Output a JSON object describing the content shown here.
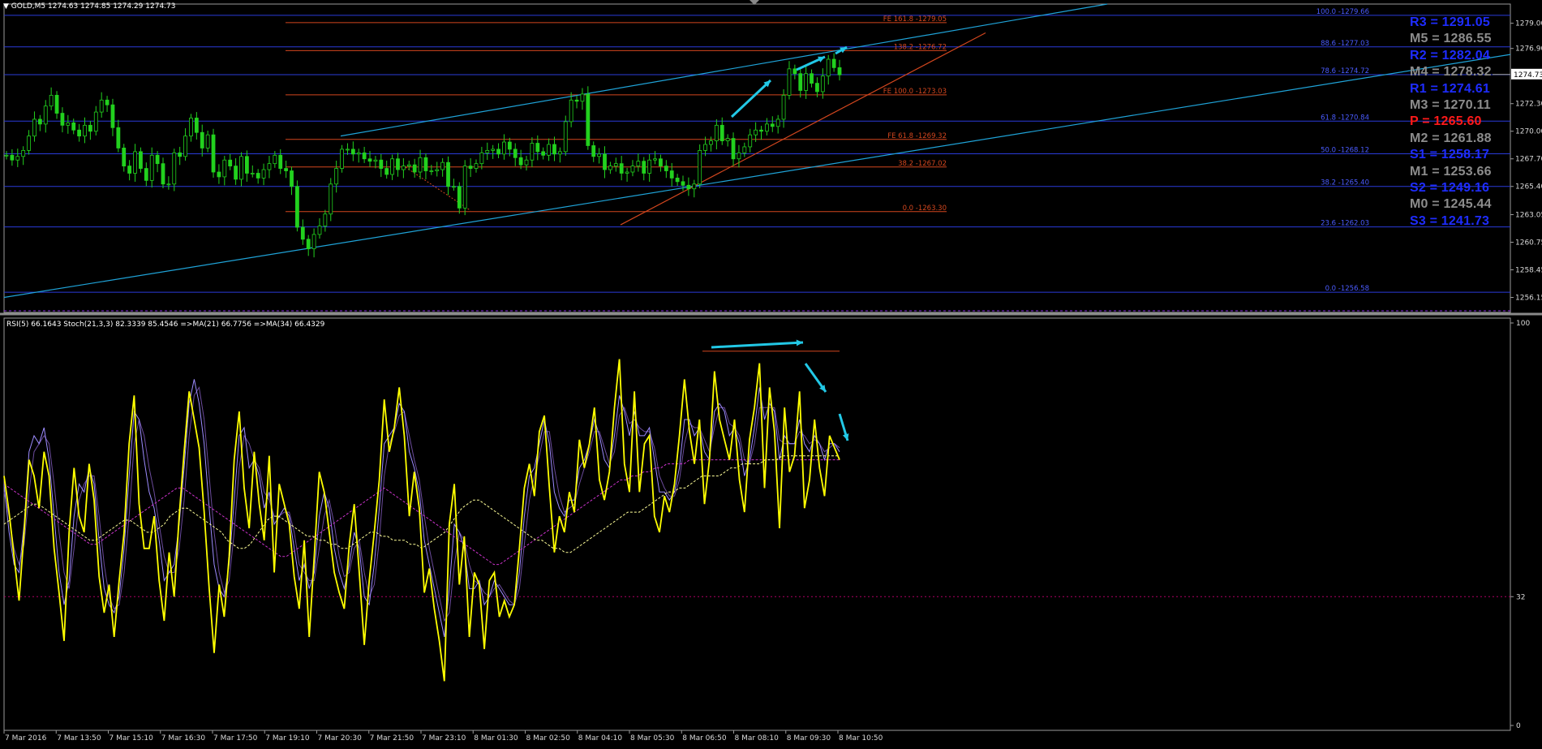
{
  "header": {
    "symbol": "GOLD,M5",
    "ohlc": "1274.63 1274.85 1274.29 1274.73"
  },
  "indicator_header": "RSI(5) 66.1643  Stoch(21,3,3) 82.3339 85.4546  =>MA(21) 66.7756  =>MA(34) 66.4329",
  "pivots": [
    {
      "label": "R3 = 1291.05",
      "color": "#1e2cff"
    },
    {
      "label": "M5 = 1286.55",
      "color": "#8c8c8c"
    },
    {
      "label": "R2 = 1282.04",
      "color": "#1e2cff"
    },
    {
      "label": "M4 = 1278.32",
      "color": "#8c8c8c"
    },
    {
      "label": "R1 = 1274.61",
      "color": "#1e2cff"
    },
    {
      "label": "M3 = 1270.11",
      "color": "#8c8c8c"
    },
    {
      "label": "P   = 1265.60",
      "color": "#ff1a1a"
    },
    {
      "label": "M2 = 1261.88",
      "color": "#8c8c8c"
    },
    {
      "label": "S1 = 1258.17",
      "color": "#1e2cff"
    },
    {
      "label": "M1 = 1253.66",
      "color": "#8c8c8c"
    },
    {
      "label": "S2 = 1249.16",
      "color": "#1e2cff"
    },
    {
      "label": "M0 = 1245.44",
      "color": "#8c8c8c"
    },
    {
      "label": "S3 = 1241.73",
      "color": "#1e2cff"
    }
  ],
  "chart_data": [
    {
      "type": "candlestick",
      "title": "GOLD,M5",
      "ylim": [
        1254.9,
        1280.6
      ],
      "price_ticks": [
        "1279.00",
        "1276.90",
        "1274.73",
        "1272.30",
        "1270.00",
        "1267.70",
        "1265.40",
        "1263.05",
        "1260.75",
        "1258.45",
        "1256.15"
      ],
      "current_price": "1274.73",
      "fib_retracement": [
        {
          "label": "100.0 -1279.66",
          "price": 1279.66
        },
        {
          "label": "88.6 -1277.03",
          "price": 1277.03
        },
        {
          "label": "78.6 -1274.72",
          "price": 1274.72
        },
        {
          "label": "61.8 -1270.84",
          "price": 1270.84
        },
        {
          "label": "50.0 -1268.12",
          "price": 1268.12
        },
        {
          "label": "38.2 -1265.40",
          "price": 1265.4
        },
        {
          "label": "23.6 -1262.03",
          "price": 1262.03
        },
        {
          "label": "0.0 -1256.58",
          "price": 1256.58
        }
      ],
      "fib_expansion": [
        {
          "label": "FE 161.8 -1279.05",
          "price": 1279.05
        },
        {
          "label": "138.2 -1276.72",
          "price": 1276.72
        },
        {
          "label": "FE 100.0 -1273.03",
          "price": 1273.03
        },
        {
          "label": "FE 61.8 -1269.32",
          "price": 1269.32
        },
        {
          "label": "38.2 -1267.02",
          "price": 1267.02
        },
        {
          "label": "0.0 -1263.30",
          "price": 1263.3
        }
      ],
      "candles_close": [
        1268.0,
        1267.6,
        1267.9,
        1268.4,
        1269.6,
        1271.0,
        1270.6,
        1272.1,
        1273.0,
        1271.5,
        1270.5,
        1270.7,
        1270.1,
        1269.6,
        1270.5,
        1270.0,
        1271.6,
        1272.6,
        1272.2,
        1270.3,
        1268.6,
        1267.1,
        1266.5,
        1268.3,
        1266.9,
        1265.9,
        1268.0,
        1267.3,
        1265.6,
        1265.6,
        1268.2,
        1267.9,
        1269.6,
        1271.1,
        1269.9,
        1268.6,
        1269.7,
        1266.6,
        1266.2,
        1267.6,
        1267.1,
        1266.0,
        1267.9,
        1266.5,
        1266.5,
        1266.1,
        1266.8,
        1267.3,
        1268.0,
        1266.9,
        1266.7,
        1265.4,
        1262.0,
        1261.0,
        1260.2,
        1261.4,
        1262.1,
        1263.1,
        1265.6,
        1266.9,
        1268.5,
        1268.5,
        1268.1,
        1268.2,
        1267.7,
        1267.5,
        1267.6,
        1266.9,
        1266.4,
        1267.7,
        1266.8,
        1267.1,
        1267.2,
        1266.6,
        1267.8,
        1266.7,
        1266.7,
        1266.8,
        1267.4,
        1265.4,
        1265.4,
        1263.6,
        1267.1,
        1266.9,
        1267.3,
        1268.2,
        1268.4,
        1268.5,
        1268.1,
        1269.1,
        1268.5,
        1267.8,
        1267.2,
        1267.6,
        1269.0,
        1268.3,
        1268.0,
        1268.9,
        1268.1,
        1268.3,
        1270.8,
        1272.6,
        1272.5,
        1273.1,
        1268.8,
        1267.9,
        1268.1,
        1266.8,
        1267.1,
        1267.3,
        1266.5,
        1266.6,
        1267.1,
        1267.5,
        1266.5,
        1267.6,
        1267.7,
        1267.1,
        1266.7,
        1266.1,
        1265.8,
        1265.5,
        1265.2,
        1265.6,
        1268.4,
        1268.9,
        1269.2,
        1270.5,
        1269.2,
        1269.4,
        1267.7,
        1268.2,
        1268.7,
        1269.7,
        1270.1,
        1270.0,
        1270.6,
        1270.4,
        1271.0,
        1273.0,
        1275.2,
        1274.8,
        1273.4,
        1274.8,
        1274.0,
        1273.3,
        1274.6,
        1276.0,
        1275.3,
        1274.7
      ],
      "time_labels": [
        "7 Mar 2016",
        "7 Mar 13:50",
        "7 Mar 15:10",
        "7 Mar 16:30",
        "7 Mar 17:50",
        "7 Mar 19:10",
        "7 Mar 20:30",
        "7 Mar 21:50",
        "7 Mar 23:10",
        "8 Mar 01:30",
        "8 Mar 02:50",
        "8 Mar 04:10",
        "8 Mar 05:30",
        "8 Mar 06:50",
        "8 Mar 08:10",
        "8 Mar 09:30",
        "8 Mar 10:50"
      ]
    },
    {
      "type": "line",
      "title": "RSI(5) 66.1643  Stoch(21,3,3) 82.3339 85.4546  =>MA(21) 66.7756  =>MA(34) 66.4329",
      "ylim": [
        0,
        100
      ],
      "y_ticks": [
        "100",
        "32",
        "0"
      ],
      "levels": [
        32
      ],
      "series": [
        {
          "name": "RSI(5)",
          "color": "#ffff00",
          "values": [
            62,
            53,
            42,
            31,
            48,
            66,
            62,
            54,
            68,
            62,
            44,
            33,
            21,
            48,
            64,
            52,
            48,
            65,
            56,
            37,
            28,
            35,
            22,
            36,
            48,
            70,
            82,
            55,
            44,
            44,
            52,
            36,
            26,
            43,
            32,
            52,
            68,
            83,
            76,
            69,
            53,
            34,
            18,
            35,
            27,
            42,
            66,
            78,
            59,
            49,
            68,
            55,
            46,
            67,
            38,
            60,
            55,
            50,
            37,
            29,
            46,
            22,
            42,
            63,
            58,
            48,
            38,
            33,
            29,
            45,
            55,
            38,
            20,
            36,
            48,
            61,
            81,
            68,
            74,
            84,
            72,
            52,
            63,
            54,
            33,
            39,
            29,
            21,
            11,
            50,
            60,
            35,
            47,
            22,
            38,
            35,
            19,
            36,
            38,
            27,
            31,
            27,
            30,
            44,
            59,
            65,
            57,
            73,
            77,
            59,
            43,
            52,
            48,
            58,
            53,
            71,
            64,
            70,
            79,
            61,
            56,
            63,
            79,
            91,
            65,
            58,
            83,
            58,
            70,
            72,
            52,
            48,
            57,
            53,
            60,
            72,
            86,
            73,
            65,
            76,
            55,
            66,
            88,
            76,
            71,
            66,
            76,
            61,
            53,
            71,
            79,
            90,
            59,
            84,
            73,
            49,
            79,
            63,
            67,
            83,
            54,
            61,
            76,
            64,
            57,
            72,
            69,
            66
          ]
        },
        {
          "name": "Stoch main",
          "color": "#9d8cff",
          "values": [
            60,
            48,
            40,
            38,
            50,
            68,
            72,
            70,
            74,
            66,
            52,
            38,
            30,
            36,
            52,
            60,
            58,
            64,
            60,
            46,
            34,
            30,
            28,
            32,
            44,
            62,
            78,
            76,
            66,
            58,
            54,
            46,
            36,
            38,
            40,
            50,
            64,
            80,
            86,
            80,
            70,
            54,
            40,
            34,
            32,
            40,
            56,
            72,
            74,
            64,
            66,
            62,
            54,
            58,
            50,
            52,
            54,
            52,
            44,
            36,
            40,
            34,
            38,
            52,
            58,
            54,
            44,
            38,
            34,
            40,
            48,
            44,
            32,
            30,
            40,
            54,
            70,
            72,
            74,
            80,
            78,
            68,
            64,
            58,
            46,
            40,
            34,
            28,
            22,
            34,
            50,
            48,
            44,
            34,
            34,
            36,
            30,
            32,
            36,
            34,
            32,
            30,
            30,
            38,
            52,
            62,
            64,
            70,
            76,
            70,
            58,
            54,
            52,
            56,
            56,
            64,
            66,
            70,
            76,
            72,
            66,
            64,
            72,
            82,
            78,
            72,
            78,
            72,
            72,
            74,
            66,
            58,
            58,
            56,
            58,
            64,
            76,
            76,
            72,
            74,
            68,
            66,
            78,
            80,
            78,
            72,
            74,
            70,
            62,
            66,
            74,
            84,
            76,
            80,
            78,
            66,
            72,
            70,
            70,
            76,
            70,
            68,
            72,
            70,
            66,
            70,
            70,
            68
          ]
        },
        {
          "name": "Stoch signal",
          "color": "#6b4b9c",
          "values": [
            58,
            52,
            44,
            40,
            45,
            58,
            68,
            70,
            72,
            70,
            60,
            48,
            38,
            34,
            44,
            56,
            60,
            62,
            62,
            52,
            40,
            32,
            29,
            30,
            38,
            52,
            70,
            76,
            72,
            64,
            58,
            50,
            42,
            38,
            38,
            44,
            56,
            72,
            82,
            84,
            76,
            62,
            48,
            38,
            33,
            36,
            48,
            64,
            72,
            70,
            66,
            64,
            58,
            56,
            52,
            52,
            53,
            53,
            48,
            40,
            38,
            36,
            36,
            44,
            52,
            56,
            50,
            42,
            37,
            38,
            44,
            46,
            38,
            32,
            35,
            46,
            62,
            70,
            73,
            77,
            78,
            72,
            66,
            61,
            52,
            44,
            38,
            32,
            26,
            28,
            40,
            48,
            46,
            40,
            36,
            35,
            33,
            32,
            34,
            35,
            33,
            31,
            30,
            34,
            45,
            56,
            62,
            67,
            73,
            73,
            64,
            57,
            53,
            54,
            55,
            60,
            64,
            68,
            73,
            73,
            69,
            65,
            68,
            77,
            79,
            75,
            76,
            74,
            73,
            73,
            69,
            62,
            59,
            57,
            57,
            61,
            70,
            75,
            74,
            74,
            71,
            68,
            74,
            79,
            79,
            75,
            74,
            72,
            66,
            65,
            70,
            79,
            79,
            79,
            79,
            71,
            70,
            70,
            70,
            73,
            72,
            70,
            71,
            70,
            68,
            69,
            70,
            69
          ]
        },
        {
          "name": "MA(21)",
          "color": "#ffff99",
          "values": [
            50,
            51,
            52,
            53,
            54,
            55,
            55,
            54,
            53,
            52,
            51,
            50,
            49,
            48,
            47,
            46,
            46,
            47,
            48,
            49,
            50,
            51,
            51,
            50,
            49,
            48,
            48,
            49,
            50,
            52,
            53,
            54,
            54,
            53,
            52,
            51,
            50,
            49,
            48,
            46,
            45,
            44,
            44,
            45,
            47,
            49,
            51,
            52,
            52,
            51,
            50,
            49,
            48,
            47,
            47,
            46,
            46,
            45,
            45,
            44,
            44,
            45,
            46,
            47,
            48,
            48,
            47,
            47,
            46,
            46,
            46,
            45,
            45,
            44,
            45,
            46,
            47,
            48,
            50,
            52,
            54,
            55,
            56,
            56,
            55,
            54,
            53,
            52,
            51,
            50,
            49,
            48,
            47,
            46,
            46,
            45,
            44,
            44,
            43,
            43,
            44,
            45,
            46,
            47,
            48,
            49,
            50,
            51,
            52,
            53,
            53,
            53,
            54,
            55,
            56,
            57,
            58,
            58,
            59,
            59,
            60,
            61,
            62,
            62,
            62,
            62,
            63,
            64,
            64,
            65,
            65,
            65,
            65,
            66,
            66,
            66,
            67,
            67,
            67,
            67,
            67,
            67,
            67,
            67,
            67,
            67,
            67
          ]
        },
        {
          "name": "MA(34)",
          "color": "#cc33cc",
          "values": [
            60,
            59,
            58,
            57,
            56,
            55,
            54,
            53,
            52,
            51,
            50,
            49,
            48,
            47,
            46,
            45,
            45,
            46,
            47,
            48,
            49,
            50,
            51,
            52,
            53,
            54,
            55,
            56,
            57,
            58,
            59,
            59,
            58,
            57,
            56,
            55,
            54,
            53,
            52,
            51,
            50,
            49,
            48,
            47,
            46,
            45,
            44,
            43,
            42,
            42,
            43,
            44,
            45,
            46,
            47,
            48,
            49,
            50,
            51,
            52,
            53,
            54,
            55,
            56,
            57,
            58,
            59,
            58,
            57,
            56,
            55,
            54,
            53,
            52,
            51,
            50,
            49,
            48,
            47,
            46,
            45,
            44,
            43,
            42,
            41,
            40,
            40,
            41,
            42,
            43,
            44,
            45,
            46,
            47,
            48,
            49,
            50,
            51,
            52,
            53,
            54,
            55,
            56,
            57,
            58,
            59,
            60,
            61,
            61,
            62,
            62,
            63,
            63,
            64,
            64,
            65,
            65,
            65,
            65,
            66,
            66,
            66,
            66,
            66,
            66,
            66,
            66,
            66,
            66,
            66,
            66,
            66,
            66,
            66,
            66,
            66,
            66,
            66,
            66,
            66,
            66,
            66,
            66,
            66,
            66,
            66
          ]
        }
      ]
    }
  ]
}
